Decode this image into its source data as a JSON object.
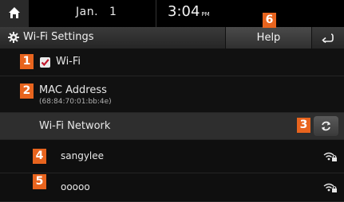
{
  "status_bar": {
    "date_month": "Jan.",
    "date_day": "1",
    "time": "3:04",
    "time_ampm": "PM"
  },
  "title_bar": {
    "title": "Wi-Fi Settings",
    "title_icon": "gear-icon",
    "help_label": "Help",
    "back_icon": "back-arrow-icon"
  },
  "wifi_row": {
    "label": "Wi-Fi",
    "checked": true
  },
  "mac_row": {
    "label": "MAC Address",
    "value": "(68:84:70:01:bb:4e)"
  },
  "network_header": {
    "label": "Wi-Fi Network",
    "refresh_icon": "refresh-icon"
  },
  "networks": [
    {
      "name": "sangylee",
      "icon": "wifi-lock-icon"
    },
    {
      "name": "ooooo",
      "icon": "wifi-lock-icon"
    }
  ],
  "callouts": [
    "1",
    "2",
    "3",
    "4",
    "5",
    "6"
  ],
  "colors": {
    "callout": "#e8641e",
    "background": "#0b0b0b",
    "header_row": "#2e2e2e"
  }
}
